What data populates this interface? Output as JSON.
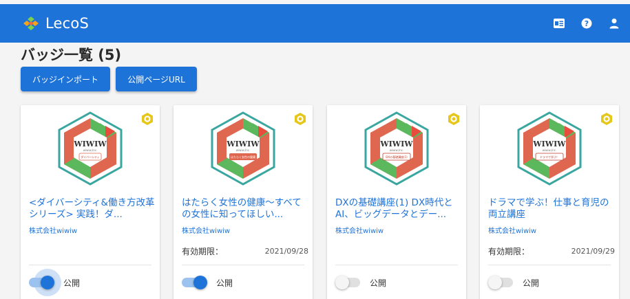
{
  "app": {
    "brand": "LecoS",
    "colors": {
      "primary": "#1e73d8",
      "badge_green": "#5cb85c",
      "badge_orange": "#e0674f",
      "badge_gold": "#e6c619"
    }
  },
  "header_icons": [
    "id-card-icon",
    "help-icon",
    "account-icon"
  ],
  "page": {
    "title": "バッジ一覧 (5)"
  },
  "actions": {
    "import_label": "バッジインポート",
    "public_url_label": "公開ページURL"
  },
  "cards": [
    {
      "title": "<ダイバーシティ&働き方改革シリーズ> 実践！ダ...",
      "org": "株式会社wiwiw",
      "badge_text": "WIWIW",
      "badge_sub": "wiwiw,Inc.",
      "badge_caption": "ダイバーシティ",
      "expiry_label": "",
      "expiry_date": "",
      "public_label": "公開",
      "public": true,
      "focused": true
    },
    {
      "title": "はたらく女性の健康～すべての女性に知ってほしい...",
      "org": "株式会社wiwiw",
      "badge_text": "WIWIW",
      "badge_sub": "wiwiw,Inc.",
      "badge_caption": "はたらく女性の健康",
      "expiry_label": "有効期限：",
      "expiry_date": "2021/09/28",
      "public_label": "公開",
      "public": true,
      "focused": false
    },
    {
      "title": "DXの基礎講座(1) DX時代とAI、ビッグデータとデー...",
      "org": "株式会社wiwiw",
      "badge_text": "WIWIW",
      "badge_sub": "wiwiw,Inc.",
      "badge_caption": "DXの基礎講座(1)",
      "expiry_label": "",
      "expiry_date": "",
      "public_label": "公開",
      "public": false,
      "focused": false
    },
    {
      "title": "ドラマで学ぶ！仕事と育児の両立講座",
      "org": "株式会社wiwiw",
      "badge_text": "WIWIW",
      "badge_sub": "wiwiw,Inc.",
      "badge_caption": "ドラマで学ぶ！",
      "expiry_label": "有効期限：",
      "expiry_date": "2021/09/29",
      "public_label": "公開",
      "public": false,
      "focused": false
    }
  ]
}
